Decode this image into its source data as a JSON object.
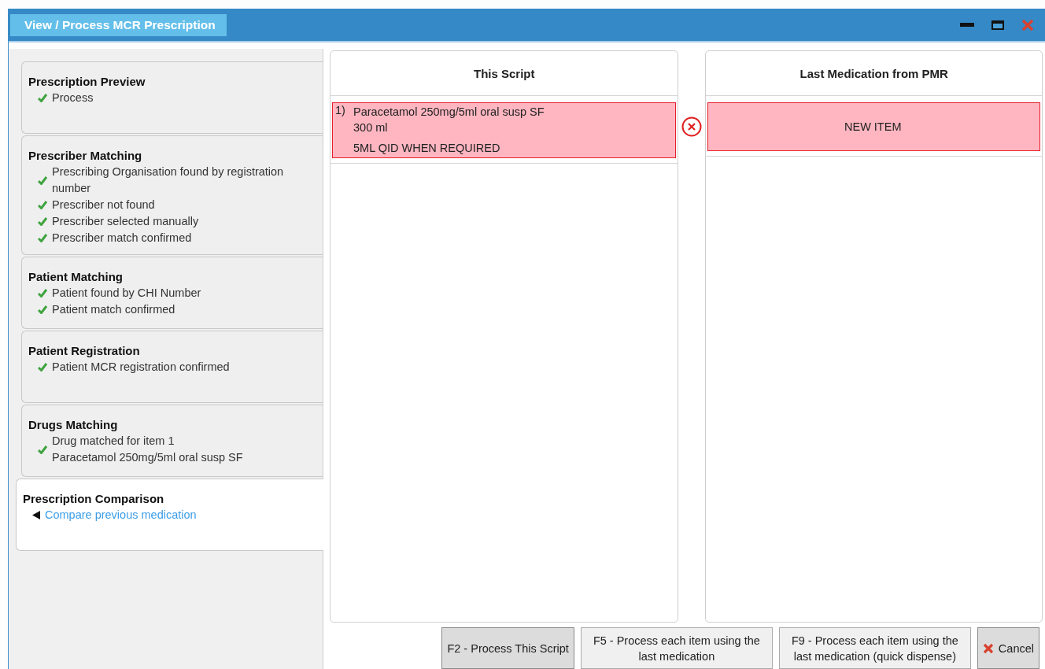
{
  "window": {
    "title": "View / Process MCR Prescription"
  },
  "steps": [
    {
      "title": "Prescription Preview",
      "selected": false,
      "items": [
        {
          "kind": "check",
          "lines": [
            "Process"
          ]
        }
      ]
    },
    {
      "title": "Prescriber Matching",
      "selected": false,
      "items": [
        {
          "kind": "check",
          "lines": [
            "Prescribing Organisation found by registration number"
          ]
        },
        {
          "kind": "check",
          "lines": [
            "Prescriber not found"
          ]
        },
        {
          "kind": "check",
          "lines": [
            "Prescriber selected manually"
          ]
        },
        {
          "kind": "check",
          "lines": [
            "Prescriber match confirmed"
          ]
        }
      ]
    },
    {
      "title": "Patient Matching",
      "selected": false,
      "items": [
        {
          "kind": "check",
          "lines": [
            "Patient found by CHI Number"
          ]
        },
        {
          "kind": "check",
          "lines": [
            "Patient match confirmed"
          ]
        }
      ]
    },
    {
      "title": "Patient Registration",
      "selected": false,
      "items": [
        {
          "kind": "check",
          "lines": [
            "Patient MCR registration confirmed"
          ]
        }
      ]
    },
    {
      "title": "Drugs Matching",
      "selected": false,
      "items": [
        {
          "kind": "check",
          "lines": [
            "Drug matched for item 1",
            "Paracetamol 250mg/5ml oral susp SF"
          ]
        }
      ]
    },
    {
      "title": "Prescription Comparison",
      "selected": true,
      "items": [
        {
          "kind": "link",
          "lines": [
            "Compare previous medication"
          ]
        }
      ]
    }
  ],
  "this_script": {
    "heading": "This Script",
    "items": [
      {
        "number": "1)",
        "drug": "Paracetamol 250mg/5ml oral susp SF",
        "quantity": "300 ml",
        "dosage": "5ML QID WHEN REQUIRED",
        "mismatch": true
      }
    ]
  },
  "last_medication": {
    "heading": "Last Medication from PMR",
    "items": [
      {
        "text": "NEW ITEM",
        "mismatch": true
      }
    ]
  },
  "buttons": [
    {
      "label": "F2 - Process This Script",
      "kind": "primary"
    },
    {
      "label": "F5 - Process each item using the last medication",
      "kind": "secondary"
    },
    {
      "label": "F9 - Process each item using the last medication (quick dispense)",
      "kind": "secondary"
    },
    {
      "label": "Cancel",
      "kind": "cancel"
    }
  ]
}
